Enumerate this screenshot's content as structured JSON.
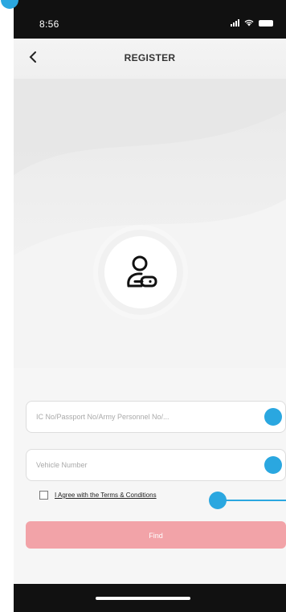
{
  "status_bar": {
    "time": "8:56"
  },
  "header": {
    "title": "REGISTER",
    "back_icon": "chevron-left-icon"
  },
  "avatar": {
    "icon": "user-key-icon"
  },
  "form": {
    "id_placeholder": "IC No/Passport No/Army Personnel No/...",
    "vehicle_placeholder": "Vehicle Number",
    "terms_label": "I Agree with the Terms & Conditions",
    "terms_checked": false,
    "find_label": "Find"
  },
  "colors": {
    "accent_disabled": "#f2a3a8",
    "marker": "#2aa7e0",
    "status_bar": "#111111"
  }
}
